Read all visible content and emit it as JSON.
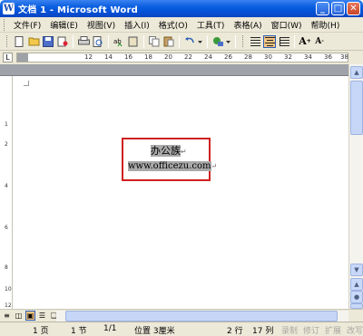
{
  "window": {
    "title": "文档 1 - Microsoft Word",
    "app_icon": "W"
  },
  "window_buttons": {
    "minimize": "_",
    "maximize": "□",
    "close": "✕"
  },
  "menu": [
    "文件(F)",
    "编辑(E)",
    "视图(V)",
    "插入(I)",
    "格式(O)",
    "工具(T)",
    "表格(A)",
    "窗口(W)",
    "帮助(H)"
  ],
  "toolbar_icons": [
    "new-doc-icon",
    "open-folder-icon",
    "save-icon",
    "permission-icon",
    "print-icon",
    "print-preview-icon",
    "spelling-icon",
    "research-icon",
    "copy-icon",
    "paste-icon",
    "undo-icon",
    "insert-hyperlink-icon",
    "align-left-icon",
    "align-center-icon",
    "justify-icon",
    "grow-font-icon",
    "shrink-font-icon"
  ],
  "ruler": {
    "corner": "L",
    "numbers": [
      "12",
      "14",
      "16",
      "18",
      "20",
      "22",
      "24",
      "26",
      "28",
      "30",
      "32",
      "34",
      "36",
      "38"
    ]
  },
  "vruler_numbers": [
    "1",
    "2",
    "4",
    "6",
    "8",
    "10",
    "12"
  ],
  "document": {
    "line1": "办公族",
    "line2": "www.officezu.com",
    "paragraph_mark": "↵"
  },
  "status": {
    "page": "1 页",
    "section": "1 节",
    "pages": "1/1",
    "position": "位置 3厘米",
    "line": "2 行",
    "column": "17 列",
    "rec": "录制",
    "trk": "修订",
    "ext": "扩展",
    "ovr": "改写"
  },
  "colors": {
    "titlebar": "#0a5ee0",
    "chrome": "#ece9d8",
    "highlight_box": "#d02020",
    "selection": "#a9a9a9"
  }
}
